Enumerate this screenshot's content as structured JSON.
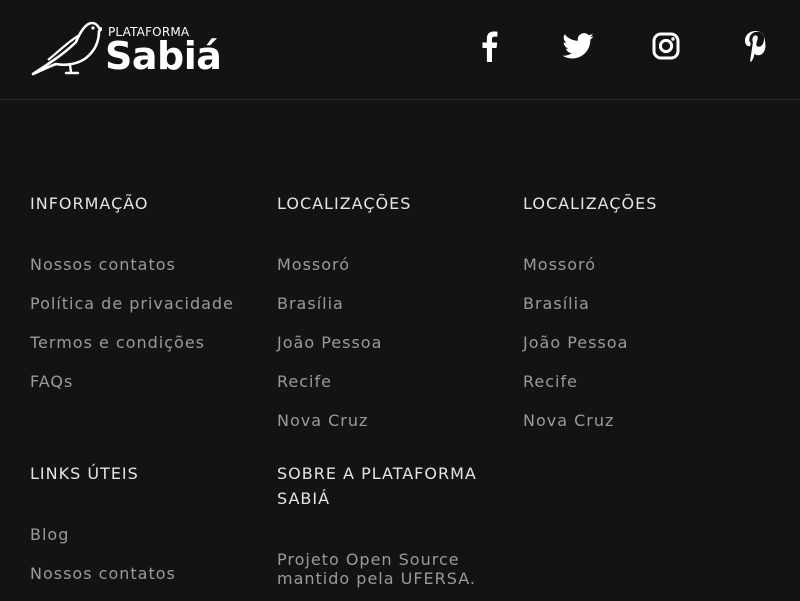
{
  "header": {
    "logo": {
      "sup": "PLATAFORMA",
      "name": "Sabiá"
    },
    "social": [
      {
        "name": "facebook-icon"
      },
      {
        "name": "twitter-icon"
      },
      {
        "name": "instagram-icon"
      },
      {
        "name": "pinterest-icon"
      }
    ]
  },
  "footer": {
    "info": {
      "title": "INFORMAÇÃO",
      "links": [
        "Nossos contatos",
        "Política de privacidade",
        "Termos e condições",
        "FAQs"
      ]
    },
    "locations_1": {
      "title": "LOCALIZAÇÕES",
      "links": [
        "Mossoró",
        "Brasília",
        "João Pessoa",
        "Recife",
        "Nova Cruz"
      ]
    },
    "locations_2": {
      "title": "LOCALIZAÇÕES",
      "links": [
        "Mossoró",
        "Brasília",
        "João Pessoa",
        "Recife",
        "Nova Cruz"
      ]
    },
    "useful": {
      "title": "LINKS ÚTEIS",
      "links": [
        "Blog",
        "Nossos contatos"
      ]
    },
    "about": {
      "title": "SOBRE A PLATAFORMA SABIÁ",
      "text": "Projeto Open Source mantido pela UFERSA."
    }
  },
  "colors": {
    "background": "#131313",
    "title": "#e4e4e4",
    "link": "#9a9a9a",
    "icon": "#ffffff"
  }
}
